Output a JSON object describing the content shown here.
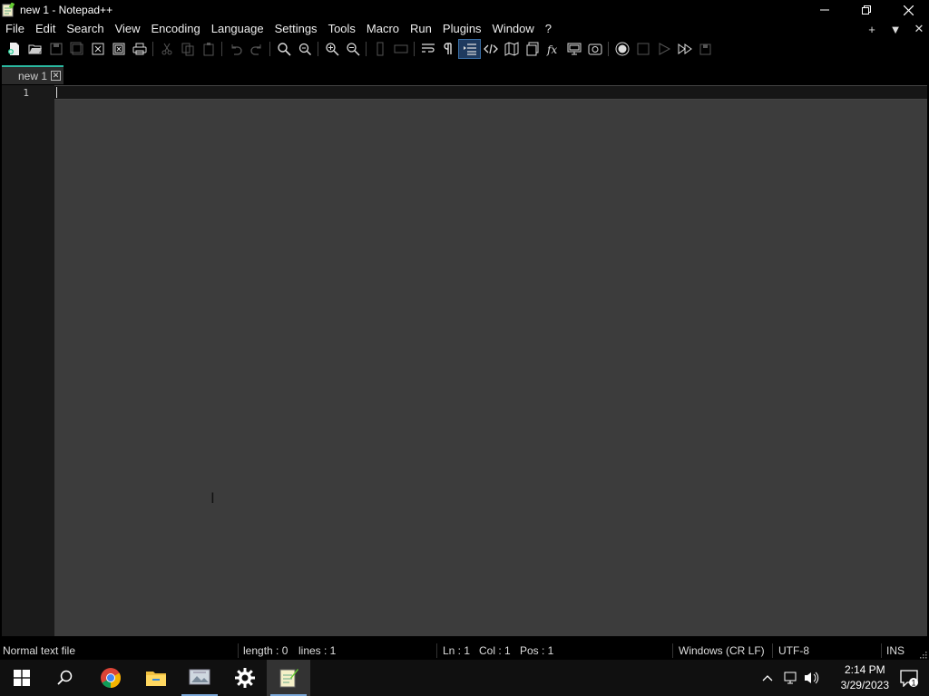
{
  "window": {
    "title": "new 1 - Notepad++",
    "controls": [
      "minimize",
      "restore",
      "close"
    ]
  },
  "menu": {
    "items": [
      "File",
      "Edit",
      "Search",
      "View",
      "Encoding",
      "Language",
      "Settings",
      "Tools",
      "Macro",
      "Run",
      "Plugins",
      "Window",
      "?"
    ],
    "right": [
      "+",
      "▼",
      "✕"
    ]
  },
  "toolbar": {
    "icons": [
      "new-file-icon",
      "open-file-icon",
      "save-icon",
      "save-all-icon",
      "close-icon",
      "close-all-icon",
      "print-icon",
      "cut-icon",
      "copy-icon",
      "paste-icon",
      "undo-icon",
      "redo-icon",
      "find-icon",
      "replace-icon",
      "zoom-in-icon",
      "zoom-out-icon",
      "sync-vertical-icon",
      "sync-horizontal-icon",
      "word-wrap-icon",
      "show-all-chars-icon",
      "indent-guide-icon",
      "xml-tag-icon",
      "document-map-icon",
      "document-list-icon",
      "function-list-icon",
      "folder-as-workspace-icon",
      "monitoring-icon",
      "record-macro-icon",
      "stop-macro-icon",
      "play-macro-icon",
      "run-macro-multiple-icon",
      "save-macro-icon"
    ],
    "active": "indent-guide-icon"
  },
  "tabs": [
    {
      "label": "new 1",
      "close": "✕"
    }
  ],
  "editor": {
    "line_numbers": [
      "1"
    ],
    "content": ""
  },
  "status": {
    "file_type": "Normal text file",
    "length": "length : 0",
    "lines": "lines : 1",
    "ln": "Ln : 1",
    "col": "Col : 1",
    "pos": "Pos : 1",
    "eol": "Windows (CR LF)",
    "encoding": "UTF-8",
    "mode": "INS"
  },
  "taskbar": {
    "apps": [
      "windows-start",
      "search",
      "chrome",
      "file-explorer",
      "photos",
      "settings",
      "notepad-plus-plus"
    ],
    "clock_time": "2:14 PM",
    "clock_date": "3/29/2023",
    "notification_count": "1"
  },
  "colors": {
    "editor_bg": "#3c3c3c",
    "gutter_bg": "#1a1a1a",
    "tab_accent": "#2ab8a0",
    "taskbar_bg": "#101010"
  }
}
